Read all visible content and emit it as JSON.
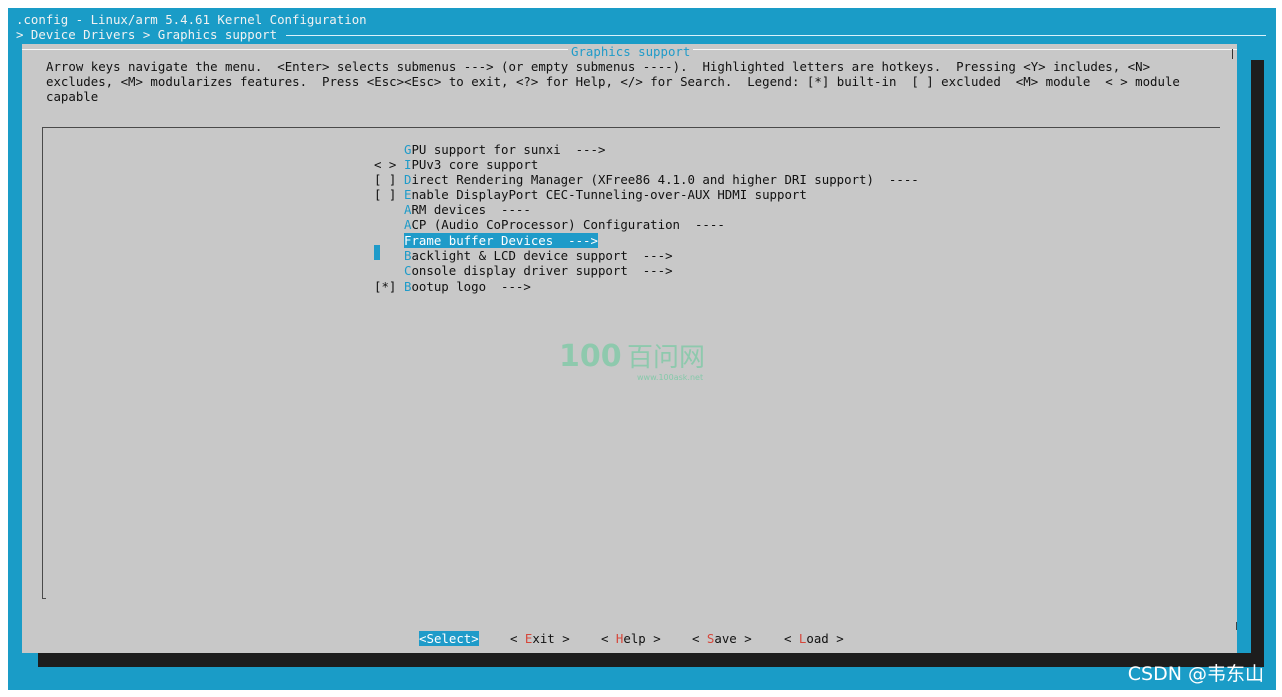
{
  "window": {
    "title": ".config - Linux/arm 5.4.61 Kernel Configuration",
    "breadcrumb": "> Device Drivers > Graphics support"
  },
  "dialog": {
    "title": "Graphics support",
    "help_lines": [
      "Arrow keys navigate the menu.  <Enter> selects submenus ---> (or empty submenus ----).  Highlighted letters are hotkeys.  Pressing <Y> includes, <N>",
      "excludes, <M> modularizes features.  Press <Esc><Esc> to exit, <?> for Help, </> for Search.  Legend: [*] built-in  [ ] excluded  <M> module  < > module",
      "capable"
    ]
  },
  "menu": {
    "items": [
      {
        "prefix": "",
        "hot": "G",
        "rest": "PU support for sunxi  --->",
        "selected": false
      },
      {
        "prefix": "< >",
        "hot": "I",
        "rest": "PUv3 core support",
        "selected": false
      },
      {
        "prefix": "[ ]",
        "hot": "D",
        "rest": "irect Rendering Manager (XFree86 4.1.0 and higher DRI support)  ----",
        "selected": false
      },
      {
        "prefix": "[ ]",
        "hot": "E",
        "rest": "nable DisplayPort CEC-Tunneling-over-AUX HDMI support",
        "selected": false
      },
      {
        "prefix": "",
        "hot": "A",
        "rest": "RM devices  ----",
        "selected": false
      },
      {
        "prefix": "",
        "hot": "A",
        "rest": "CP (Audio CoProcessor) Configuration  ----",
        "selected": false
      },
      {
        "prefix": "",
        "hot": "F",
        "rest": "rame buffer Devices  --->",
        "selected": true
      },
      {
        "prefix": "",
        "hot": "B",
        "rest": "acklight & LCD device support  --->",
        "selected": false
      },
      {
        "prefix": "",
        "hot": "C",
        "rest": "onsole display driver support  --->",
        "selected": false
      },
      {
        "prefix": "[*]",
        "hot": "B",
        "rest": "ootup logo  --->",
        "selected": false
      }
    ]
  },
  "watermark": {
    "logo_text": "100",
    "cn_text": "百问网",
    "url": "www.100ask.net"
  },
  "buttons": [
    {
      "name": "select",
      "open": "<",
      "hot": "S",
      "rest": "elect",
      "close": ">",
      "active": true
    },
    {
      "name": "exit",
      "open": "< ",
      "hot": "E",
      "rest": "xit",
      "close": " >",
      "active": false
    },
    {
      "name": "help",
      "open": "< ",
      "hot": "H",
      "rest": "elp",
      "close": " >",
      "active": false
    },
    {
      "name": "save",
      "open": "< ",
      "hot": "S",
      "rest": "ave",
      "close": " >",
      "active": false
    },
    {
      "name": "load",
      "open": "< ",
      "hot": "L",
      "rest": "oad",
      "close": " >",
      "active": false
    }
  ],
  "footer_watermark": "CSDN @韦东山",
  "colors": {
    "background": "#1a9cc7",
    "dialog": "#c8c8c8",
    "highlight": "#1f9bc9",
    "button_hotkey": "#d6463a"
  }
}
